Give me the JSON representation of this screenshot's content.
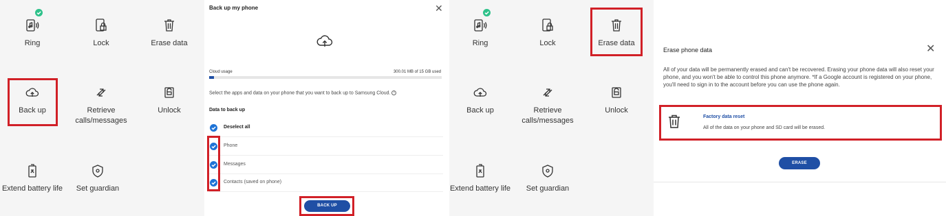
{
  "grid_tiles": {
    "ring": "Ring",
    "lock": "Lock",
    "erase": "Erase data",
    "backup": "Back up",
    "retrieve": "Retrieve calls/messages",
    "unlock": "Unlock",
    "battery": "Extend battery life",
    "guardian": "Set guardian"
  },
  "backup_dialog": {
    "title": "Back up my phone",
    "usage_label": "Cloud usage",
    "usage_value": "300.01 MB of 15 GB used",
    "usage_fraction": 0.02,
    "description": "Select the apps and data on your phone that you want to back up to Samsung Cloud.",
    "section_label": "Data to back up",
    "deselect_all": "Deselect all",
    "items": [
      "Phone",
      "Messages",
      "Contacts (saved on phone)"
    ],
    "button": "BACK UP"
  },
  "erase_dialog": {
    "title": "Erase phone data",
    "text": "All of your data will be permanently erased and can't be recovered. Erasing your phone data will also reset your phone, and you won't be able to control this phone anymore. *If a Google account is registered on your phone, you'll need to sign in to the account before you can use the phone again.",
    "option_title": "Factory data reset",
    "option_desc": "All of the data on your phone and SD card will be erased.",
    "button": "ERASE"
  },
  "colors": {
    "highlight": "#d12027",
    "accent_blue": "#1f4fa5",
    "check_green": "#2ec18a",
    "checkbox_blue": "#1e73d6"
  }
}
